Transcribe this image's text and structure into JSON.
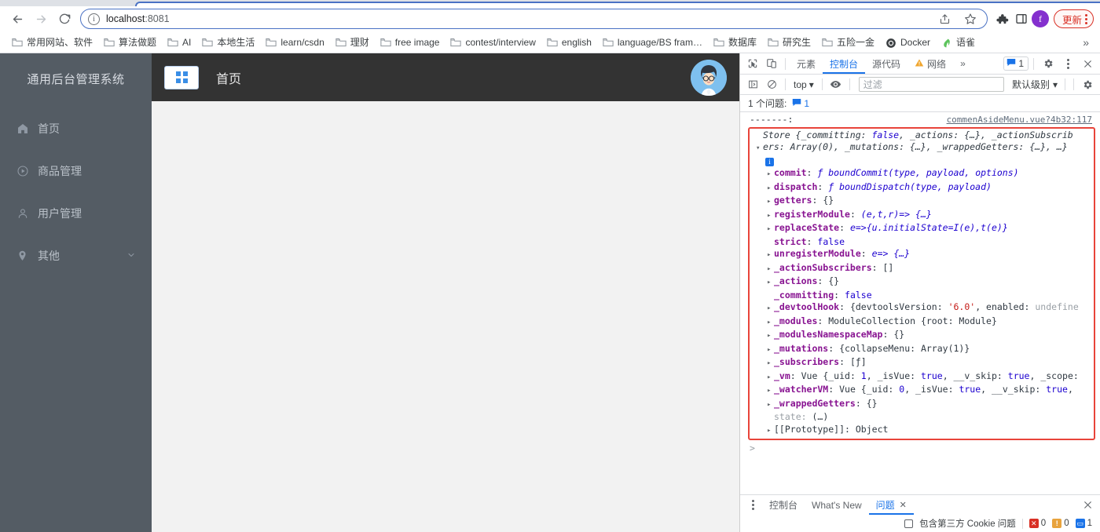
{
  "browser": {
    "url_host": "localhost",
    "url_rest": ":8081",
    "back_icon": "back-arrow-icon",
    "forward_icon": "forward-arrow-icon",
    "reload_icon": "reload-icon",
    "site_info_icon": "info-icon",
    "share_icon": "share-icon",
    "bookmark_icon": "star-icon",
    "extensions_icon": "puzzle-icon",
    "sidepanel_icon": "side-panel-icon",
    "profile_initial": "f",
    "update_label": "更新",
    "menu_icon": "kebab-menu-icon",
    "accent_blue": "#4a72c4",
    "update_red": "#d93025"
  },
  "bookmarks": {
    "items": [
      {
        "label": "常用网站、软件"
      },
      {
        "label": "算法做题"
      },
      {
        "label": "AI"
      },
      {
        "label": "本地生活"
      },
      {
        "label": "learn/csdn"
      },
      {
        "label": "理财"
      },
      {
        "label": "free image"
      },
      {
        "label": "contest/interview"
      },
      {
        "label": "english"
      },
      {
        "label": "language/BS fram…"
      },
      {
        "label": "数据库"
      },
      {
        "label": "研究生"
      },
      {
        "label": "五险一金"
      },
      {
        "label": "Docker"
      },
      {
        "label": "语雀"
      }
    ],
    "overflow_label": "»"
  },
  "app": {
    "sidebar": {
      "title": "通用后台管理系统",
      "bg_color": "#545c64",
      "items": [
        {
          "label": "首页",
          "icon": "home-icon"
        },
        {
          "label": "商品管理",
          "icon": "play-circle-icon"
        },
        {
          "label": "用户管理",
          "icon": "user-icon"
        },
        {
          "label": "其他",
          "icon": "location-pin-icon",
          "chevron": "chevron-down-icon"
        }
      ]
    },
    "header": {
      "title": "首页",
      "collapse_icon": "grid-menu-icon",
      "avatar": "user-avatar",
      "bg_color": "#333333"
    }
  },
  "devtools": {
    "tabs": [
      {
        "label": "元素",
        "active": false
      },
      {
        "label": "控制台",
        "active": true
      },
      {
        "label": "源代码",
        "active": false
      },
      {
        "label": "网络",
        "active": false,
        "warn": true
      }
    ],
    "overflow_label": "»",
    "message_count": "1",
    "inspect_icon": "inspect-element-icon",
    "device_icon": "device-toolbar-icon",
    "settings_icon": "gear-icon",
    "more_icon": "kebab-menu-icon",
    "close_icon": "close-icon",
    "toolbar": {
      "sidebar_icon": "console-sidebar-icon",
      "clear_icon": "clear-console-icon",
      "context": "top",
      "context_chevron": "chevron-down-icon",
      "eye_icon": "live-expression-icon",
      "filter_placeholder": "过滤",
      "level": "默认级别",
      "level_chevron": "chevron-down-icon",
      "settings_icon": "gear-icon"
    },
    "issues_bar": {
      "text": "1 个问题:",
      "count": "1",
      "icon": "issue-message-icon"
    },
    "console": {
      "separator": "-------:",
      "source": "commenAsideMenu.vue?4b32:117",
      "preview_line1_a": "Store {",
      "preview_line1_b": "_committing: ",
      "preview_line1_false": "false",
      "preview_line1_c": ", _actions: {…}, _actionSubscrib",
      "preview_line2": "ers: Array(0), _mutations: {…}, _wrappedGetters: {…}, …}",
      "info_glyph": "i",
      "properties": [
        {
          "expandable": true,
          "key": "commit",
          "value": "ƒ boundCommit(type, payload, options)",
          "vtype": "fn"
        },
        {
          "expandable": true,
          "key": "dispatch",
          "value": "ƒ boundDispatch(type, payload)",
          "vtype": "fn"
        },
        {
          "expandable": true,
          "key": "getters",
          "value": "{}",
          "vtype": "plain"
        },
        {
          "expandable": true,
          "key": "registerModule",
          "value": "(e,t,r)=> {…}",
          "vtype": "fn"
        },
        {
          "expandable": true,
          "key": "replaceState",
          "value": "e=>{u.initialState=I(e),t(e)}",
          "vtype": "fn"
        },
        {
          "expandable": false,
          "key": "strict",
          "value": "false",
          "vtype": "bool"
        },
        {
          "expandable": true,
          "key": "unregisterModule",
          "value": "e=> {…}",
          "vtype": "fn"
        },
        {
          "expandable": true,
          "key": "_actionSubscribers",
          "value": "[]",
          "vtype": "plain"
        },
        {
          "expandable": true,
          "key": "_actions",
          "value": "{}",
          "vtype": "plain"
        },
        {
          "expandable": false,
          "key": "_committing",
          "value": "false",
          "vtype": "bool"
        },
        {
          "expandable": true,
          "key": "_devtoolHook",
          "value": "{devtoolsVersion: '6.0', enabled: undefine",
          "vtype": "mixed"
        },
        {
          "expandable": true,
          "key": "_modules",
          "value": "ModuleCollection {root: Module}",
          "vtype": "plain"
        },
        {
          "expandable": true,
          "key": "_modulesNamespaceMap",
          "value": "{}",
          "vtype": "plain"
        },
        {
          "expandable": true,
          "key": "_mutations",
          "value": "{collapseMenu: Array(1)}",
          "vtype": "plain"
        },
        {
          "expandable": true,
          "key": "_subscribers",
          "value": "[ƒ]",
          "vtype": "plain"
        },
        {
          "expandable": true,
          "key": "_vm",
          "value": "Vue {_uid: 1, _isVue: true, __v_skip: true, _scope:",
          "vtype": "mixed"
        },
        {
          "expandable": true,
          "key": "_watcherVM",
          "value": "Vue {_uid: 0, _isVue: true, __v_skip: true,",
          "vtype": "mixed"
        },
        {
          "expandable": true,
          "key": "_wrappedGetters",
          "value": "{}",
          "vtype": "plain"
        },
        {
          "expandable": false,
          "key": "state",
          "value": "(…)",
          "vtype": "dim"
        },
        {
          "expandable": true,
          "key": "[[Prototype]]",
          "value": "Object",
          "vtype": "proto"
        }
      ],
      "prompt": ">",
      "highlight_color": "#e8443a"
    },
    "drawer": {
      "more_icon": "kebab-menu-icon",
      "tabs": [
        {
          "label": "控制台",
          "active": false,
          "closable": false
        },
        {
          "label": "What's New",
          "active": false,
          "closable": false
        },
        {
          "label": "问题",
          "active": true,
          "closable": true
        }
      ],
      "close_icon": "close-icon",
      "checkbox_label": "包含第三方 Cookie 问题",
      "counts": {
        "errors": "0",
        "warnings": "0",
        "info": "1"
      }
    }
  }
}
